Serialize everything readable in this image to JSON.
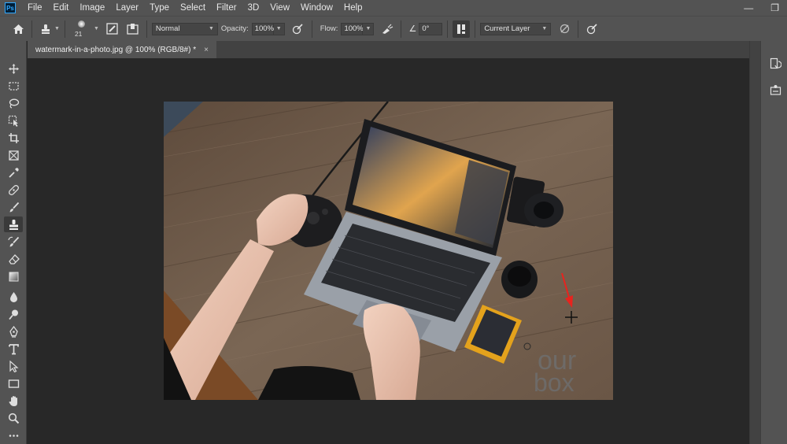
{
  "app": {
    "logo_text": "Ps"
  },
  "menu": [
    "File",
    "Edit",
    "Image",
    "Layer",
    "Type",
    "Select",
    "Filter",
    "3D",
    "View",
    "Window",
    "Help"
  ],
  "window_controls": {
    "minimize": "—",
    "restore": "❐"
  },
  "options": {
    "brush_size": "21",
    "blend_mode": "Normal",
    "opacity_label": "Opacity:",
    "opacity_value": "100%",
    "flow_label": "Flow:",
    "flow_value": "100%",
    "angle_value": "0°",
    "sample_mode": "Current Layer"
  },
  "document": {
    "tab_title": "watermark-in-a-photo.jpg @ 100% (RGB/8#) *",
    "close": "×"
  },
  "watermark": {
    "line1": "our",
    "line2": "box"
  },
  "colors": {
    "panel": "#535353",
    "canvas": "#282828",
    "accent_arrow": "#e8231e"
  },
  "tools": [
    "move-icon",
    "marquee-icon",
    "lasso-icon",
    "object-select-icon",
    "crop-icon",
    "frame-icon",
    "eyedropper-icon",
    "healing-brush-icon",
    "brush-icon",
    "clone-stamp-icon",
    "history-brush-icon",
    "eraser-icon",
    "gradient-icon",
    "blur-icon",
    "dodge-icon",
    "pen-icon",
    "type-icon",
    "path-select-icon",
    "rectangle-icon",
    "hand-icon",
    "zoom-icon",
    "more-tools-icon"
  ]
}
